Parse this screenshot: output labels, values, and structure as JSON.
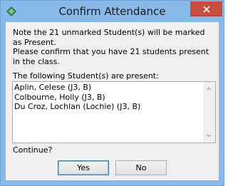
{
  "window": {
    "title": "Confirm Attendance",
    "titlebar_color": "#88b9e9",
    "close_button_color": "#c74d3f",
    "icons": {
      "app": "app-diamond-icon",
      "close": "close-icon"
    }
  },
  "message": {
    "line1": "Note the 21 unmarked Student(s) will be marked as Present.",
    "line2": "Please confirm that you have 21 students present in the class."
  },
  "list": {
    "label": "The following Student(s) are present:",
    "items": [
      "Aplin, Celese (J3, B)",
      "Colbourne, Holly (J3, B)",
      "Du Croz, Lochlan (Lochie) (J3, B)"
    ]
  },
  "prompt": "Continue?",
  "buttons": {
    "yes": "Yes",
    "no": "No"
  }
}
